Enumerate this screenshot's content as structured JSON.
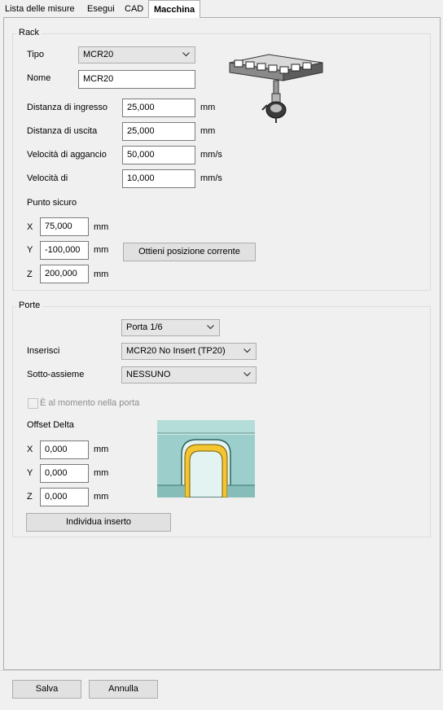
{
  "tabs": [
    {
      "label": "Lista delle misure"
    },
    {
      "label": "Esegui"
    },
    {
      "label": "CAD"
    },
    {
      "label": "Macchina"
    }
  ],
  "rack": {
    "title": "Rack",
    "tipo_label": "Tipo",
    "tipo_value": "MCR20",
    "nome_label": "Nome",
    "nome_value": "MCR20",
    "distanza_ingresso_label": "Distanza di ingresso",
    "distanza_ingresso_value": "25,000",
    "distanza_uscita_label": "Distanza di uscita",
    "distanza_uscita_value": "25,000",
    "velocita_aggancio_label": "Velocità di aggancio",
    "velocita_aggancio_value": "50,000",
    "velocita_di_label": "Velocità di",
    "velocita_di_value": "10,000",
    "unit_mm": "mm",
    "unit_mms": "mm/s",
    "punto_sicuro_label": "Punto sicuro",
    "x_label": "X",
    "x_value": "75,000",
    "y_label": "Y",
    "y_value": "-100,000",
    "z_label": "Z",
    "z_value": "200,000",
    "ottieni_button": "Ottieni posizione corrente"
  },
  "porte": {
    "title": "Porte",
    "porta_value": "Porta 1/6",
    "inserisci_label": "Inserisci",
    "inserisci_value": "MCR20 No Insert (TP20)",
    "sotto_label": "Sotto-assieme",
    "sotto_value": "NESSUNO",
    "al_momento_label": "È al momento nella porta",
    "offset_label": "Offset Delta",
    "x_label": "X",
    "x_value": "0,000",
    "y_label": "Y",
    "y_value": "0,000",
    "z_label": "Z",
    "z_value": "0,000",
    "unit_mm": "mm",
    "individua_button": "Individua inserto"
  },
  "footer": {
    "salva": "Salva",
    "annulla": "Annulla"
  },
  "icons": {
    "rack_image": "rack-probe-icon",
    "insert_image": "port-insert-icon",
    "combo_arrow": "chevron-down-icon"
  },
  "colors": {
    "background": "#f0f0f0",
    "insert_teal": "#a9d6d6",
    "insert_yellow": "#f2c531"
  }
}
